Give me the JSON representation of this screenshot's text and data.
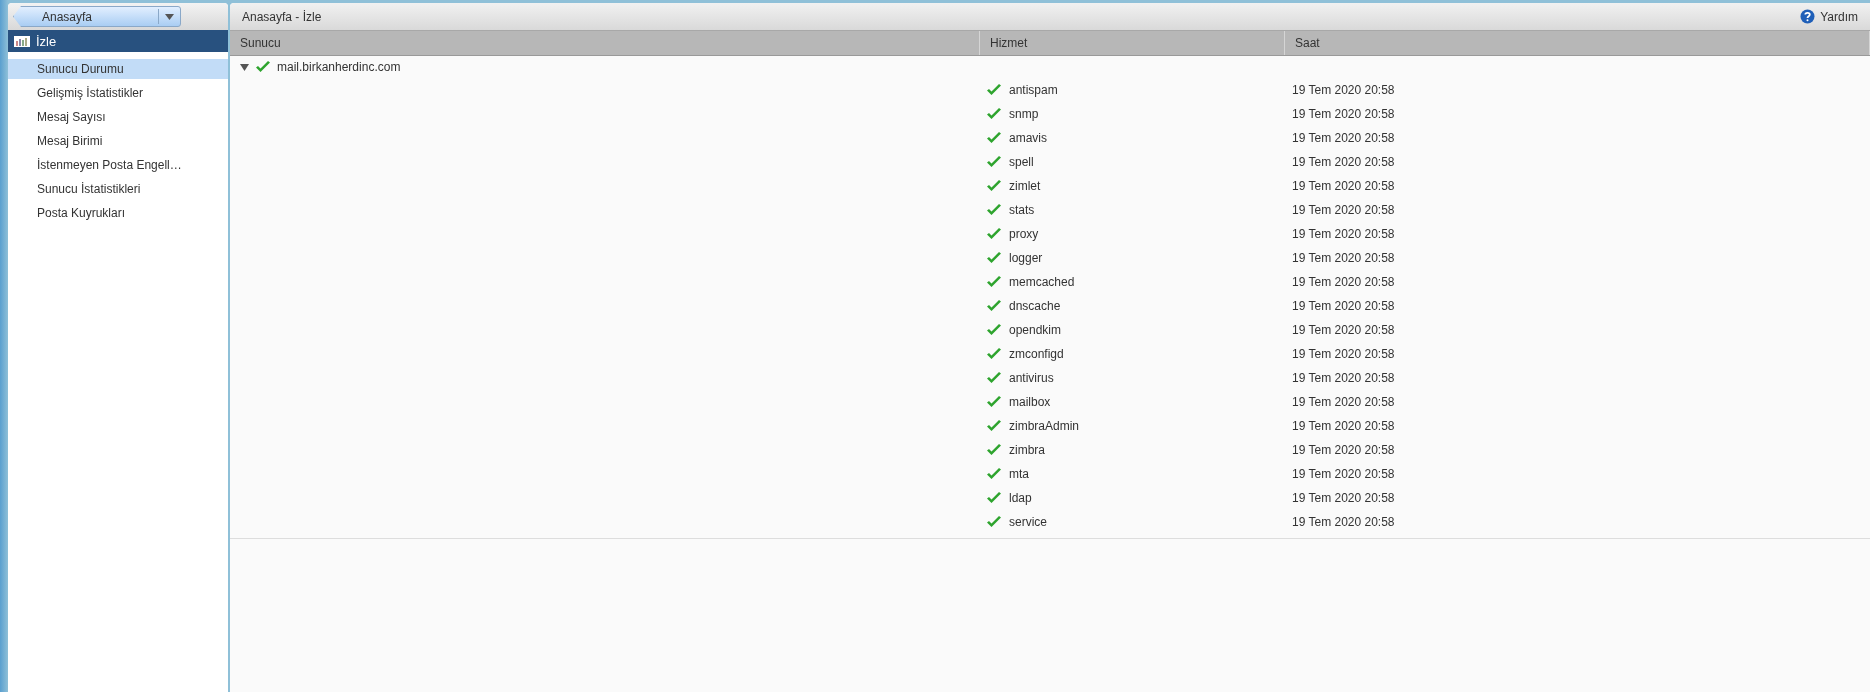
{
  "nav": {
    "back_button": "Anasayfa"
  },
  "sidebar": {
    "section": "İzle",
    "items": [
      {
        "label": "Sunucu Durumu",
        "selected": true
      },
      {
        "label": "Gelişmiş İstatistikler",
        "selected": false
      },
      {
        "label": "Mesaj Sayısı",
        "selected": false
      },
      {
        "label": "Mesaj Birimi",
        "selected": false
      },
      {
        "label": "İstenmeyen Posta Engell…",
        "selected": false
      },
      {
        "label": "Sunucu İstatistikleri",
        "selected": false
      },
      {
        "label": "Posta Kuyrukları",
        "selected": false
      }
    ]
  },
  "toolbar": {
    "breadcrumb": "Anasayfa - İzle",
    "help": "Yardım"
  },
  "table": {
    "columns": [
      "Sunucu",
      "Hizmet",
      "Saat"
    ],
    "server": {
      "name": "mail.birkanherdinc.com",
      "running": true,
      "expanded": true
    },
    "rows": [
      {
        "service": "antispam",
        "running": true,
        "time": "19 Tem 2020 20:58"
      },
      {
        "service": "snmp",
        "running": true,
        "time": "19 Tem 2020 20:58"
      },
      {
        "service": "amavis",
        "running": true,
        "time": "19 Tem 2020 20:58"
      },
      {
        "service": "spell",
        "running": true,
        "time": "19 Tem 2020 20:58"
      },
      {
        "service": "zimlet",
        "running": true,
        "time": "19 Tem 2020 20:58"
      },
      {
        "service": "stats",
        "running": true,
        "time": "19 Tem 2020 20:58"
      },
      {
        "service": "proxy",
        "running": true,
        "time": "19 Tem 2020 20:58"
      },
      {
        "service": "logger",
        "running": true,
        "time": "19 Tem 2020 20:58"
      },
      {
        "service": "memcached",
        "running": true,
        "time": "19 Tem 2020 20:58"
      },
      {
        "service": "dnscache",
        "running": true,
        "time": "19 Tem 2020 20:58"
      },
      {
        "service": "opendkim",
        "running": true,
        "time": "19 Tem 2020 20:58"
      },
      {
        "service": "zmconfigd",
        "running": true,
        "time": "19 Tem 2020 20:58"
      },
      {
        "service": "antivirus",
        "running": true,
        "time": "19 Tem 2020 20:58"
      },
      {
        "service": "mailbox",
        "running": true,
        "time": "19 Tem 2020 20:58"
      },
      {
        "service": "zimbraAdmin",
        "running": true,
        "time": "19 Tem 2020 20:58"
      },
      {
        "service": "zimbra",
        "running": true,
        "time": "19 Tem 2020 20:58"
      },
      {
        "service": "mta",
        "running": true,
        "time": "19 Tem 2020 20:58"
      },
      {
        "service": "ldap",
        "running": true,
        "time": "19 Tem 2020 20:58"
      },
      {
        "service": "service",
        "running": true,
        "time": "19 Tem 2020 20:58"
      }
    ]
  }
}
